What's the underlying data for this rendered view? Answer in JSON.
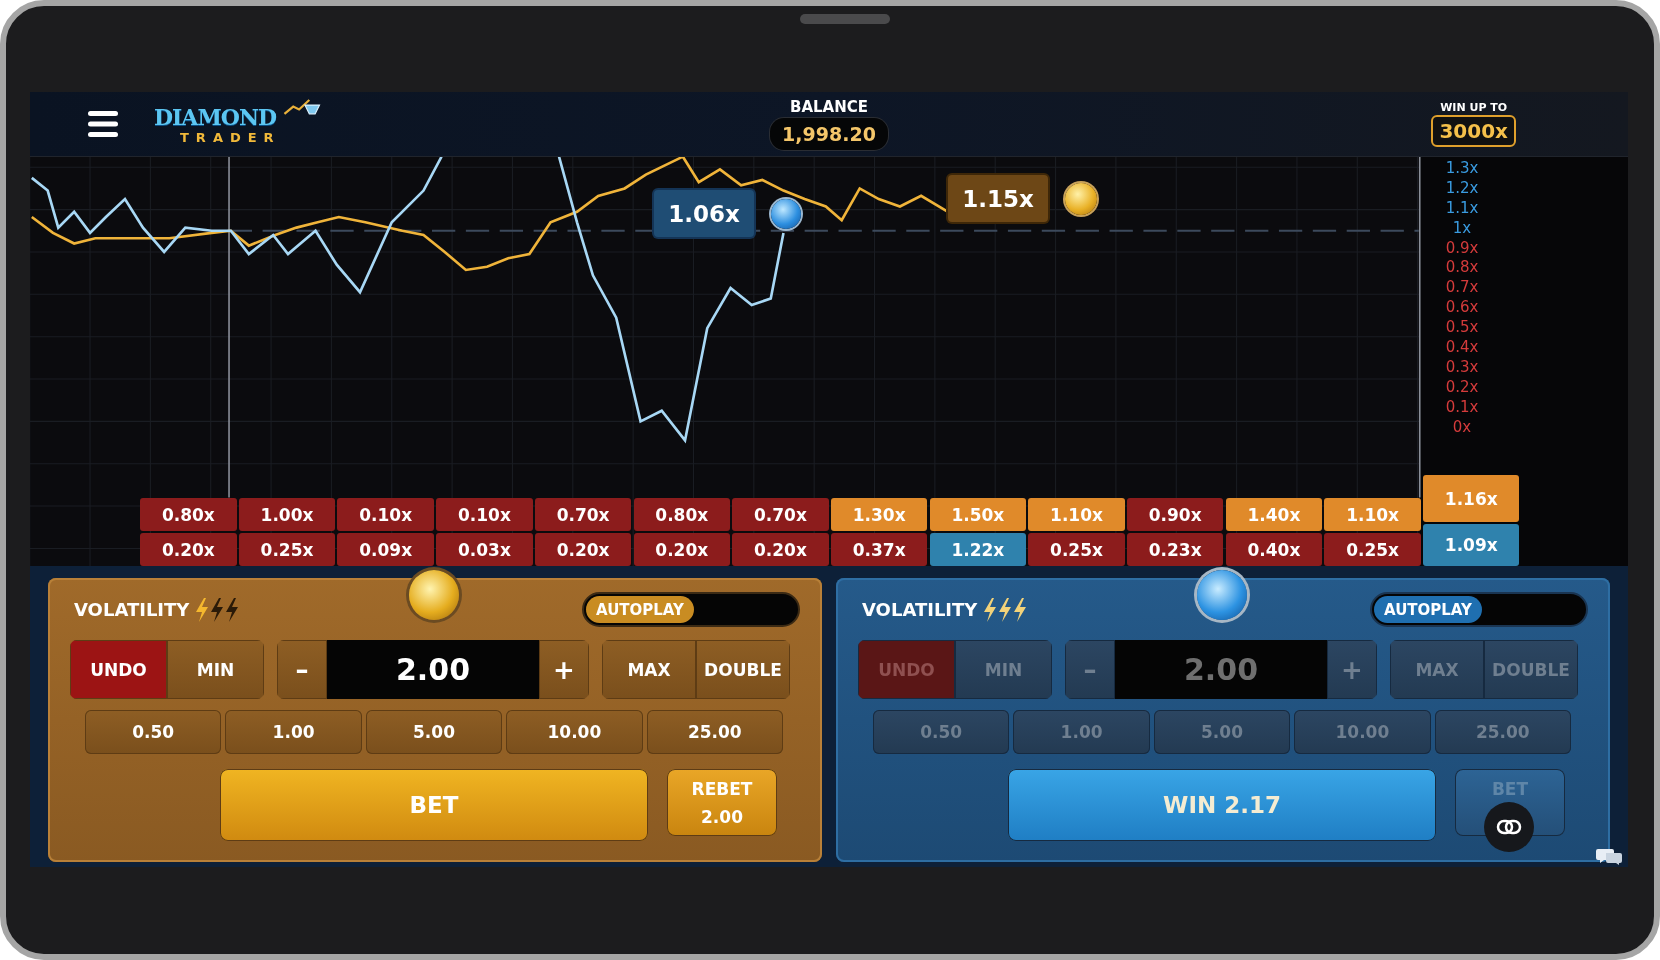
{
  "header": {
    "logo": {
      "title": "DIAMOND",
      "subtitle": "TRADER"
    },
    "balance": {
      "label": "BALANCE",
      "value": "1,998.20"
    },
    "win_up_to": {
      "label": "WIN UP TO",
      "value": "3000x"
    }
  },
  "chart": {
    "axis_labels": [
      {
        "text": "1.3x",
        "color": "#3a9be0"
      },
      {
        "text": "1.2x",
        "color": "#3a9be0"
      },
      {
        "text": "1.1x",
        "color": "#3a9be0"
      },
      {
        "text": "1x",
        "color": "#3a9be0"
      },
      {
        "text": "0.9x",
        "color": "#d43b3b"
      },
      {
        "text": "0.8x",
        "color": "#d43b3b"
      },
      {
        "text": "0.7x",
        "color": "#d43b3b"
      },
      {
        "text": "0.6x",
        "color": "#d43b3b"
      },
      {
        "text": "0.5x",
        "color": "#d43b3b"
      },
      {
        "text": "0.4x",
        "color": "#d43b3b"
      },
      {
        "text": "0.3x",
        "color": "#d43b3b"
      },
      {
        "text": "0.2x",
        "color": "#d43b3b"
      },
      {
        "text": "0.1x",
        "color": "#d43b3b"
      },
      {
        "text": "0x",
        "color": "#d43b3b"
      }
    ],
    "markers": [
      {
        "kind": "blue",
        "text": "1.06x"
      },
      {
        "kind": "gold",
        "text": "1.15x"
      }
    ]
  },
  "history": [
    {
      "top": {
        "text": "0.80x",
        "color": "#8c1c1c"
      },
      "bottom": {
        "text": "0.20x",
        "color": "#8c1c1c"
      }
    },
    {
      "top": {
        "text": "1.00x",
        "color": "#8c1c1c"
      },
      "bottom": {
        "text": "0.25x",
        "color": "#8c1c1c"
      }
    },
    {
      "top": {
        "text": "0.10x",
        "color": "#8c1c1c"
      },
      "bottom": {
        "text": "0.09x",
        "color": "#8c1c1c"
      }
    },
    {
      "top": {
        "text": "0.10x",
        "color": "#8c1c1c"
      },
      "bottom": {
        "text": "0.03x",
        "color": "#8c1c1c"
      }
    },
    {
      "top": {
        "text": "0.70x",
        "color": "#8c1c1c"
      },
      "bottom": {
        "text": "0.20x",
        "color": "#8c1c1c"
      }
    },
    {
      "top": {
        "text": "0.80x",
        "color": "#8c1c1c"
      },
      "bottom": {
        "text": "0.20x",
        "color": "#8c1c1c"
      }
    },
    {
      "top": {
        "text": "0.70x",
        "color": "#8c1c1c"
      },
      "bottom": {
        "text": "0.20x",
        "color": "#8c1c1c"
      }
    },
    {
      "top": {
        "text": "1.30x",
        "color": "#e08a2a"
      },
      "bottom": {
        "text": "0.37x",
        "color": "#8c1c1c"
      }
    },
    {
      "top": {
        "text": "1.50x",
        "color": "#e08a2a"
      },
      "bottom": {
        "text": "1.22x",
        "color": "#2f82ad"
      }
    },
    {
      "top": {
        "text": "1.10x",
        "color": "#e08a2a"
      },
      "bottom": {
        "text": "0.25x",
        "color": "#8c1c1c"
      }
    },
    {
      "top": {
        "text": "0.90x",
        "color": "#8c1c1c"
      },
      "bottom": {
        "text": "0.23x",
        "color": "#8c1c1c"
      }
    },
    {
      "top": {
        "text": "1.40x",
        "color": "#e08a2a"
      },
      "bottom": {
        "text": "0.40x",
        "color": "#8c1c1c"
      }
    },
    {
      "top": {
        "text": "1.10x",
        "color": "#e08a2a"
      },
      "bottom": {
        "text": "0.25x",
        "color": "#8c1c1c"
      }
    }
  ],
  "current": {
    "top": {
      "text": "1.16x",
      "color": "#e08a2a"
    },
    "bottom": {
      "text": "1.09x",
      "color": "#2f82ad"
    }
  },
  "panels": [
    {
      "kind": "gold",
      "disabled": false,
      "volatility": {
        "label": "VOLATILITY",
        "stars": 1
      },
      "autoplay": {
        "label": "AUTOPLAY",
        "on": false
      },
      "undo": "UNDO",
      "min": "MIN",
      "minus": "–",
      "amount": "2.00",
      "plus": "+",
      "max": "MAX",
      "double": "DOUBLE",
      "chips": [
        "0.50",
        "1.00",
        "5.00",
        "10.00",
        "25.00"
      ],
      "main_button": "BET",
      "side_button": [
        "REBET",
        "2.00"
      ]
    },
    {
      "kind": "blue",
      "disabled": true,
      "volatility": {
        "label": "VOLATILITY",
        "stars": 3
      },
      "autoplay": {
        "label": "AUTOPLAY",
        "on": false
      },
      "undo": "UNDO",
      "min": "MIN",
      "minus": "–",
      "amount": "2.00",
      "plus": "+",
      "max": "MAX",
      "double": "DOUBLE",
      "chips": [
        "0.50",
        "1.00",
        "5.00",
        "10.00",
        "25.00"
      ],
      "main_button": "WIN 2.17",
      "side_button": [
        "BET"
      ]
    }
  ]
}
